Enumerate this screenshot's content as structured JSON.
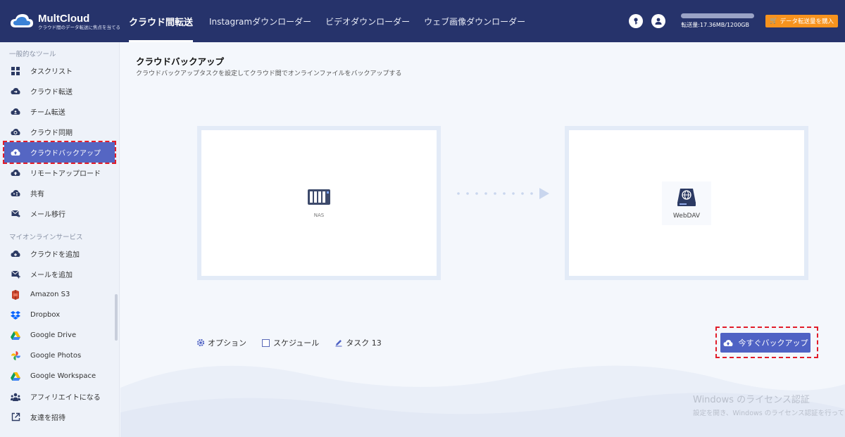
{
  "app": {
    "name": "MultCloud",
    "tagline": "クラウド間のデータ転送に焦点を当てる"
  },
  "nav": {
    "items": [
      {
        "label": "クラウド間転送",
        "active": true
      },
      {
        "label": "Instagramダウンローダー",
        "active": false
      },
      {
        "label": "ビデオダウンローダー",
        "active": false
      },
      {
        "label": "ウェブ画像ダウンローダー",
        "active": false
      }
    ]
  },
  "header": {
    "usage_text": "転送量:17.36MB/1200GB",
    "usage_fraction": 1.45e-05,
    "buy_label": "データ転送量を購入"
  },
  "sidebar": {
    "section1_title": "一般的なツール",
    "tools": [
      {
        "label": "タスクリスト",
        "icon": "task-list-icon"
      },
      {
        "label": "クラウド転送",
        "icon": "cloud-transfer-icon"
      },
      {
        "label": "チーム転送",
        "icon": "team-transfer-icon"
      },
      {
        "label": "クラウド同期",
        "icon": "cloud-sync-icon"
      },
      {
        "label": "クラウドバックアップ",
        "icon": "cloud-backup-icon",
        "active": true
      },
      {
        "label": "リモートアップロード",
        "icon": "remote-upload-icon"
      },
      {
        "label": "共有",
        "icon": "share-icon"
      },
      {
        "label": "メール移行",
        "icon": "email-migration-icon"
      }
    ],
    "section2_title": "マイオンラインサービス",
    "services": [
      {
        "label": "クラウドを追加",
        "icon": "add-cloud-icon"
      },
      {
        "label": "メールを追加",
        "icon": "add-email-icon"
      },
      {
        "label": "Amazon S3",
        "icon": "amazon-s3-icon"
      },
      {
        "label": "Dropbox",
        "icon": "dropbox-icon"
      },
      {
        "label": "Google Drive",
        "icon": "google-drive-icon"
      },
      {
        "label": "Google Photos",
        "icon": "google-photos-icon"
      },
      {
        "label": "Google Workspace",
        "icon": "google-workspace-icon"
      },
      {
        "label": "アフィリエイトになる",
        "icon": "affiliate-icon"
      },
      {
        "label": "友達を招待",
        "icon": "invite-icon"
      }
    ]
  },
  "main": {
    "title": "クラウドバックアップ",
    "description": "クラウドバックアップタスクを設定してクラウド間でオンラインファイルをバックアップする",
    "source_label": "NAS",
    "target_label": "WebDAV",
    "options_label": "オプション",
    "schedule_label": "スケジュール",
    "task_label": "タスク 13",
    "backup_button": "今すぐバックアップ"
  },
  "watermark": {
    "line1": "Windows のライセンス認証",
    "line2": "設定を開き、Windows のライセンス認証を行ってください"
  },
  "colors": {
    "topbar": "#26336b",
    "accent": "#5566c3",
    "button": "#4f62c4",
    "buy": "#f7931e",
    "highlight": "#e11d2a"
  }
}
